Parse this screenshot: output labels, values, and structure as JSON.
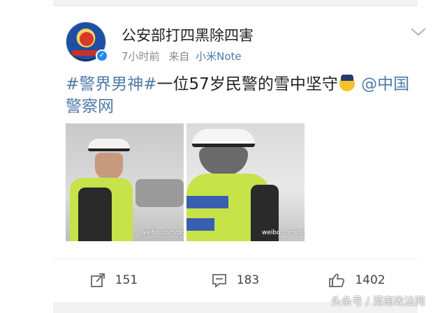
{
  "post": {
    "author": "公安部打四黑除四害",
    "time": "7小时前",
    "via": "来自",
    "source": "小米Note",
    "content": {
      "hashtag": "#警界男神#",
      "text": "一位57岁民警的雪中坚守",
      "mention": "@中国警察网"
    },
    "images": [
      {
        "watermark": "weibo.com/ddc"
      },
      {
        "watermark": "weibo.com/ddc"
      }
    ]
  },
  "actions": {
    "repost_count": "151",
    "comment_count": "183",
    "like_count": "1402"
  },
  "page_watermark": "头条号 / 渭南政法网",
  "colors": {
    "link": "#4e7ba7",
    "verified": "#1d8bf1",
    "background": "#f2f2f2"
  }
}
